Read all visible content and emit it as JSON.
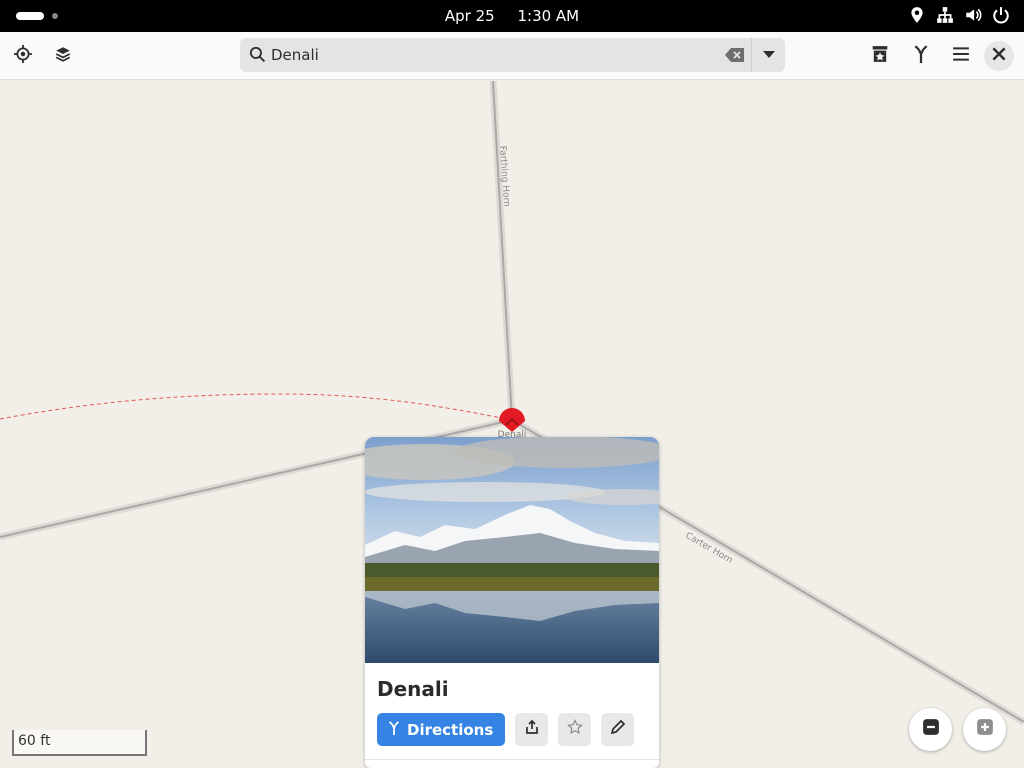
{
  "system_bar": {
    "date": "Apr 25",
    "time": "1:30 AM",
    "tray_icons": [
      "location-icon",
      "network-icon",
      "volume-icon",
      "power-icon"
    ]
  },
  "header": {
    "left_buttons": [
      "my-location-icon",
      "layers-icon"
    ],
    "search": {
      "value": "Denali",
      "placeholder": ""
    },
    "right_buttons": [
      "favorites-icon",
      "route-icon",
      "menu-icon",
      "close-icon"
    ]
  },
  "map": {
    "road_labels": [
      "Farthing Horn",
      "Carter Horn"
    ],
    "marker_label": "Denali",
    "scale": "60 ft"
  },
  "place_card": {
    "title": "Denali",
    "directions_label": "Directions",
    "secondary_actions": [
      "share-icon",
      "favorite-star-icon",
      "edit-icon"
    ]
  },
  "zoom": {
    "out": "zoom-out-icon",
    "in": "zoom-in-icon"
  },
  "colors": {
    "accent": "#3584e4",
    "marker": "#e01b24",
    "map_background": "#f2efe9",
    "route_dashed": "#e05a4f"
  }
}
